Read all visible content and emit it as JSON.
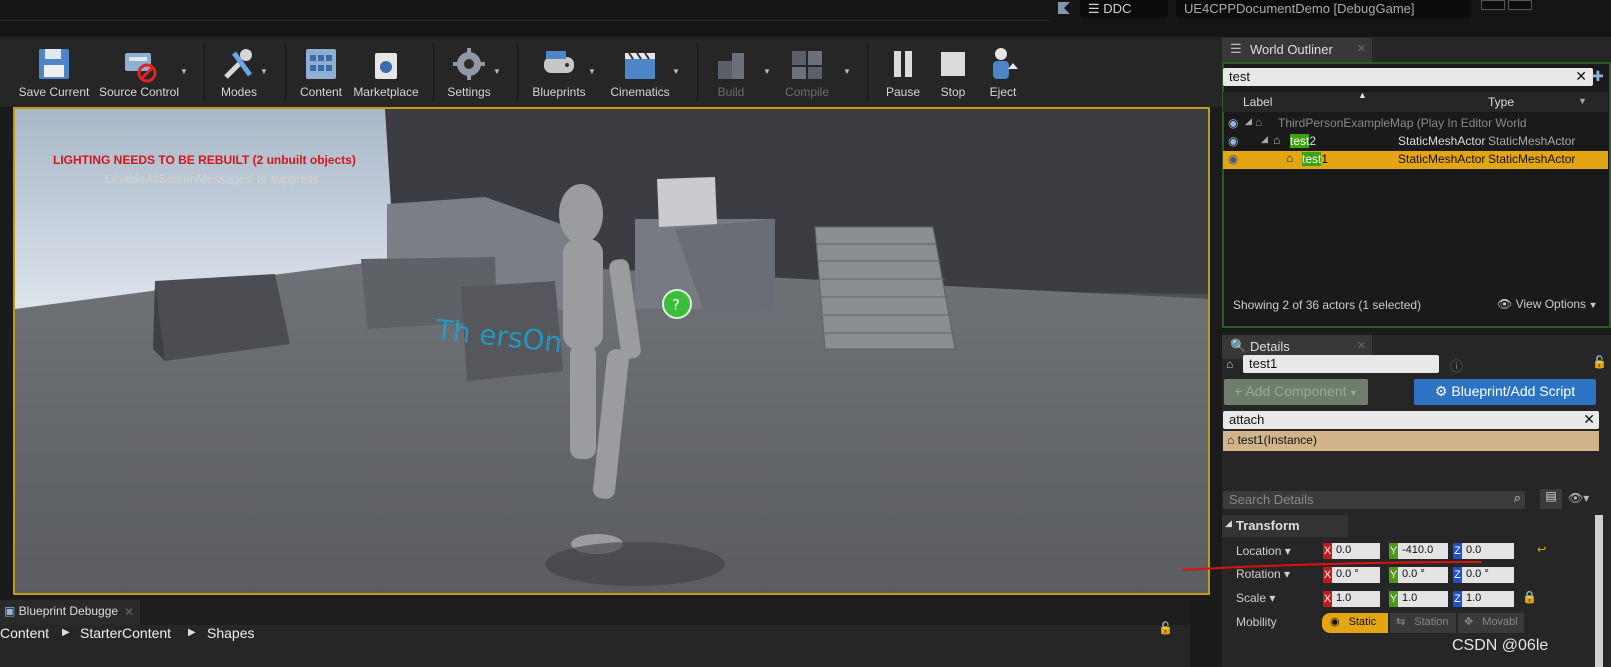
{
  "title_bar": {
    "ddc_label": "DDC",
    "project_title": "UE4CPPDocumentDemo [DebugGame]"
  },
  "toolbar": {
    "items": [
      {
        "label": "Save Current",
        "icon": "floppy-disk-icon"
      },
      {
        "label": "Source Control",
        "icon": "source-control-icon"
      },
      {
        "label": "Modes",
        "icon": "modes-tools-icon"
      },
      {
        "label": "Content",
        "icon": "content-grid-icon"
      },
      {
        "label": "Marketplace",
        "icon": "marketplace-bag-icon"
      },
      {
        "label": "Settings",
        "icon": "gear-icon"
      },
      {
        "label": "Blueprints",
        "icon": "gamepad-icon"
      },
      {
        "label": "Cinematics",
        "icon": "clapperboard-icon"
      },
      {
        "label": "Build",
        "icon": "build-blocks-icon"
      },
      {
        "label": "Compile",
        "icon": "compile-cubes-icon"
      },
      {
        "label": "Pause",
        "icon": "pause-icon"
      },
      {
        "label": "Stop",
        "icon": "stop-icon"
      },
      {
        "label": "Eject",
        "icon": "eject-icon"
      }
    ]
  },
  "viewport": {
    "warning": "LIGHTING NEEDS TO BE REBUILT (2 unbuilt objects)",
    "suppress_hint": "'DisableAllScreenMessages' to suppress"
  },
  "outliner": {
    "tab_label": "World Outliner",
    "search_value": "test",
    "columns": {
      "label": "Label",
      "type": "Type"
    },
    "rows": [
      {
        "label": "ThirdPersonExampleMap (Play In Editor World",
        "type": ""
      },
      {
        "label_hl": "test",
        "label_rest": "2",
        "actor": "StaticMeshActor",
        "type": "StaticMeshActor"
      },
      {
        "label_hl": "test",
        "label_rest": "1",
        "actor": "StaticMeshActor",
        "type": "StaticMeshActor"
      }
    ],
    "status": "Showing 2 of 36 actors (1 selected)",
    "view_options": "View Options"
  },
  "details": {
    "tab_label": "Details",
    "name_value": "test1",
    "add_component": "+ Add Component",
    "blueprint_button": "Blueprint/Add Script",
    "component_search": "attach",
    "instance_label": "test1(Instance)",
    "search_placeholder": "Search Details",
    "section_title": "Transform",
    "location_label": "Location",
    "rotation_label": "Rotation",
    "scale_label": "Scale",
    "mobility_label": "Mobility",
    "location": {
      "x": "0.0",
      "y": "-410.0",
      "z": "0.0"
    },
    "rotation": {
      "x": "0.0 °",
      "y": "0.0 °",
      "z": "0.0 °"
    },
    "scale": {
      "x": "1.0",
      "y": "1.0",
      "z": "1.0"
    },
    "mobility_options": [
      "Static",
      "Station",
      "Movabl"
    ]
  },
  "bottom": {
    "tab_label": "Blueprint Debugge",
    "breadcrumb": [
      "Content",
      "StarterContent",
      "Shapes"
    ]
  },
  "watermark": "CSDN @06le",
  "colors": {
    "accent_selected": "#e3a512",
    "highlight_match": "#3aa30f",
    "warning_text": "#d01818",
    "blueprint_button": "#2c73c4"
  }
}
